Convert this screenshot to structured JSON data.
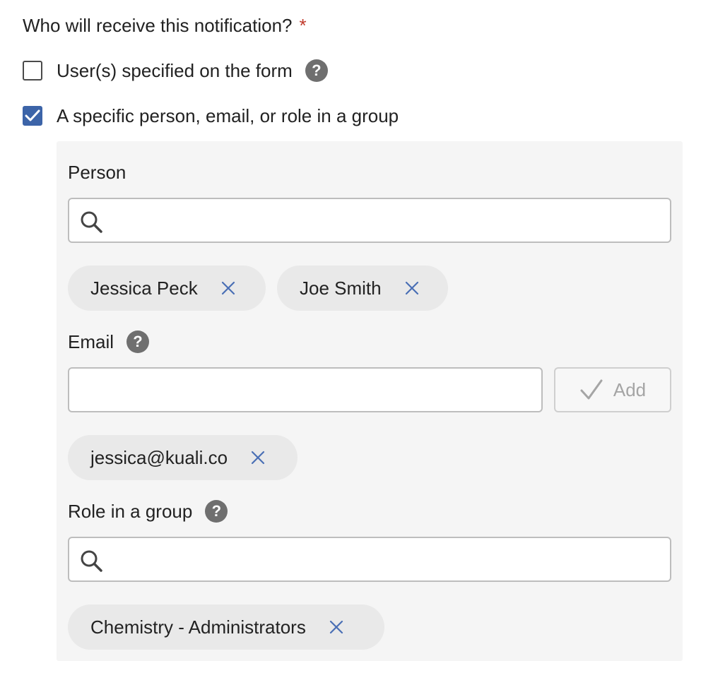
{
  "question": {
    "text": "Who will receive this notification?",
    "required_marker": "*"
  },
  "options": [
    {
      "label": "User(s) specified on the form",
      "checked": false,
      "help": "?"
    },
    {
      "label": "A specific person, email, or role in a group",
      "checked": true
    }
  ],
  "person": {
    "label": "Person",
    "input_value": "",
    "chips": [
      {
        "label": "Jessica Peck"
      },
      {
        "label": "Joe Smith"
      }
    ]
  },
  "email": {
    "label": "Email",
    "help": "?",
    "input_value": "",
    "add_label": "Add",
    "chips": [
      {
        "label": "jessica@kuali.co"
      }
    ]
  },
  "role": {
    "label": "Role in a group",
    "help": "?",
    "input_value": "",
    "chips": [
      {
        "label": "Chemistry - Administrators"
      }
    ]
  },
  "colors": {
    "accent": "#3c64a8",
    "required": "#c0392b",
    "chip_bg": "#e9e9e9",
    "panel_bg": "#f5f5f5",
    "remove_icon": "#4a6fb5"
  },
  "icons": {
    "search": "search-icon",
    "help": "question-circle-icon",
    "remove": "close-icon",
    "check": "check-icon"
  }
}
